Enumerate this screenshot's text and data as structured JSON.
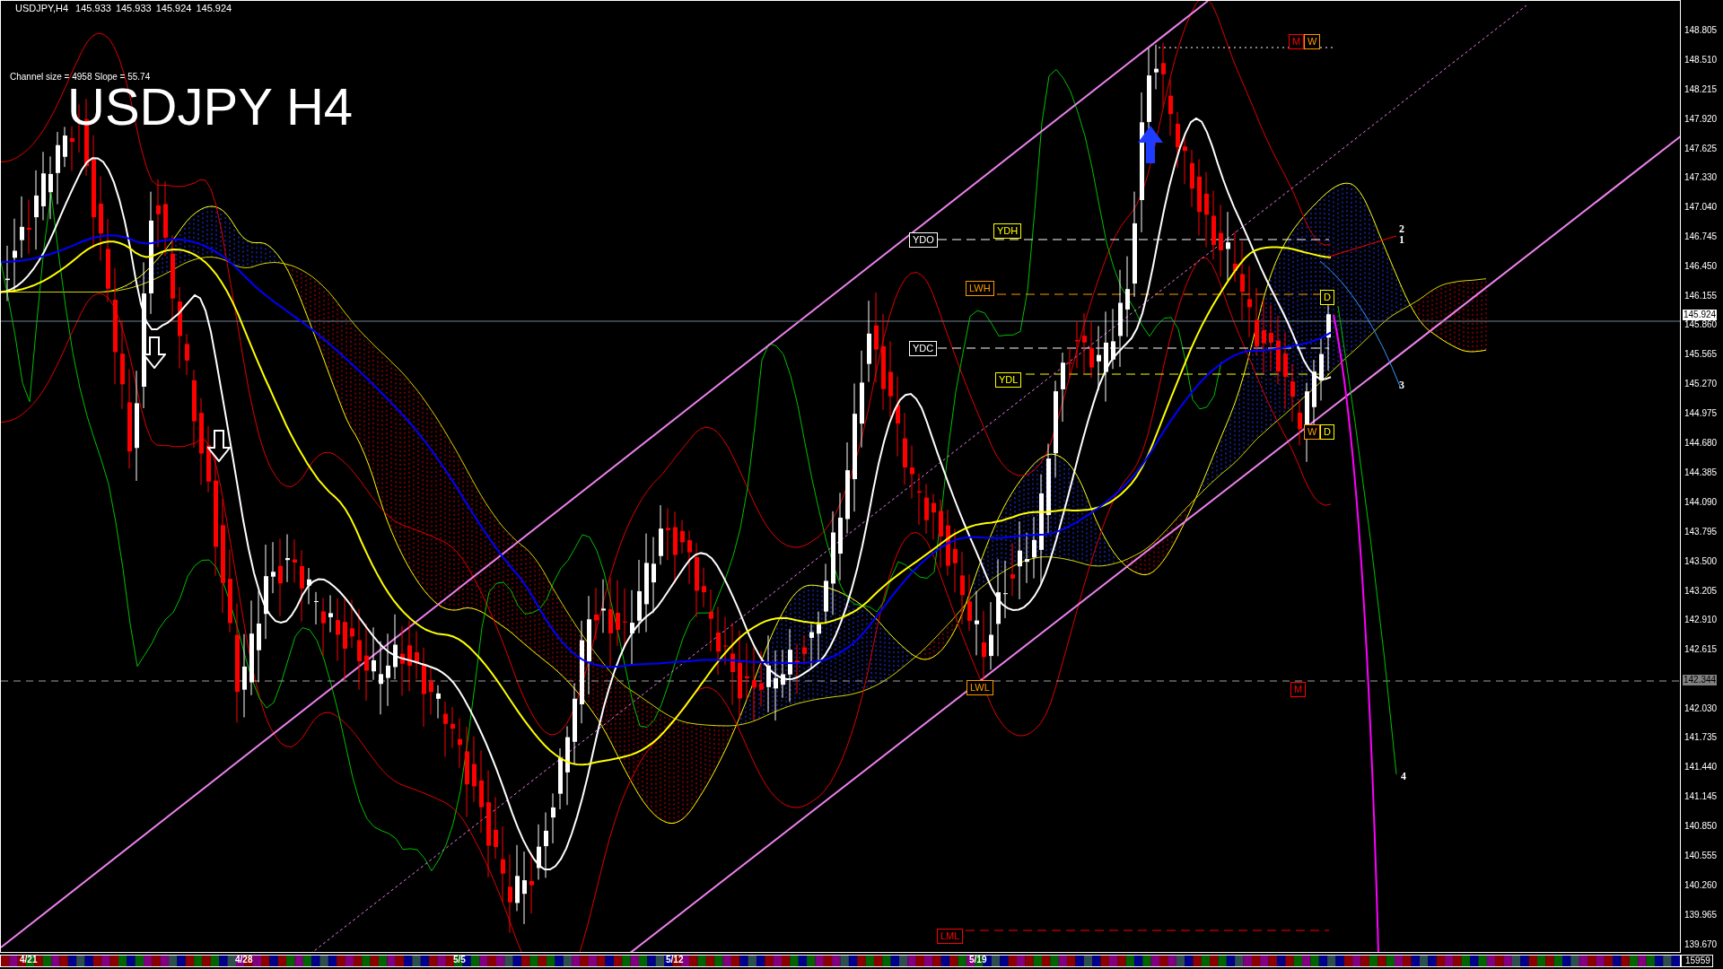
{
  "header": {
    "symbol": "USDJPY,H4",
    "values": [
      "145.933",
      "145.933",
      "145.924",
      "145.924"
    ]
  },
  "channel_info": "Channel size = 4958 Slope = 55.74",
  "chart_title": "USDJPY H4",
  "level_labels": [
    {
      "text": "YDO",
      "color": "#ffffff"
    },
    {
      "text": "YDH",
      "color": "#ffff00"
    },
    {
      "text": "LWH",
      "color": "#ff9900"
    },
    {
      "text": "YDC",
      "color": "#ffffff"
    },
    {
      "text": "YDL",
      "color": "#ffff00"
    },
    {
      "text": "D",
      "color": "#ffff00"
    },
    {
      "text": "W",
      "color": "#ff9900"
    },
    {
      "text": "D",
      "color": "#ffff00"
    },
    {
      "text": "M",
      "color": "#ff0000"
    },
    {
      "text": "W",
      "color": "#ff9900"
    },
    {
      "text": "LWL",
      "color": "#ff9900"
    },
    {
      "text": "M",
      "color": "#ff0000"
    },
    {
      "text": "LML",
      "color": "#ff0000"
    }
  ],
  "wave_labels": [
    "2",
    "1",
    "3",
    "4"
  ],
  "price_axis": [
    "148.805",
    "148.510",
    "148.215",
    "147.920",
    "147.625",
    "147.330",
    "147.040",
    "146.745",
    "146.450",
    "146.155",
    "145.860",
    "145.565",
    "145.270",
    "144.975",
    "144.680",
    "144.385",
    "144.090",
    "143.795",
    "143.500",
    "143.205",
    "142.910",
    "142.615",
    "142.030",
    "141.735",
    "141.440",
    "141.145",
    "140.850",
    "140.555",
    "140.260",
    "139.965",
    "139.670"
  ],
  "current_price": "145.924",
  "line_price": "142.344",
  "time_axis": [
    "4/21",
    "4/28",
    "5/5",
    "5/12",
    "5/19"
  ],
  "counter": "15959"
}
